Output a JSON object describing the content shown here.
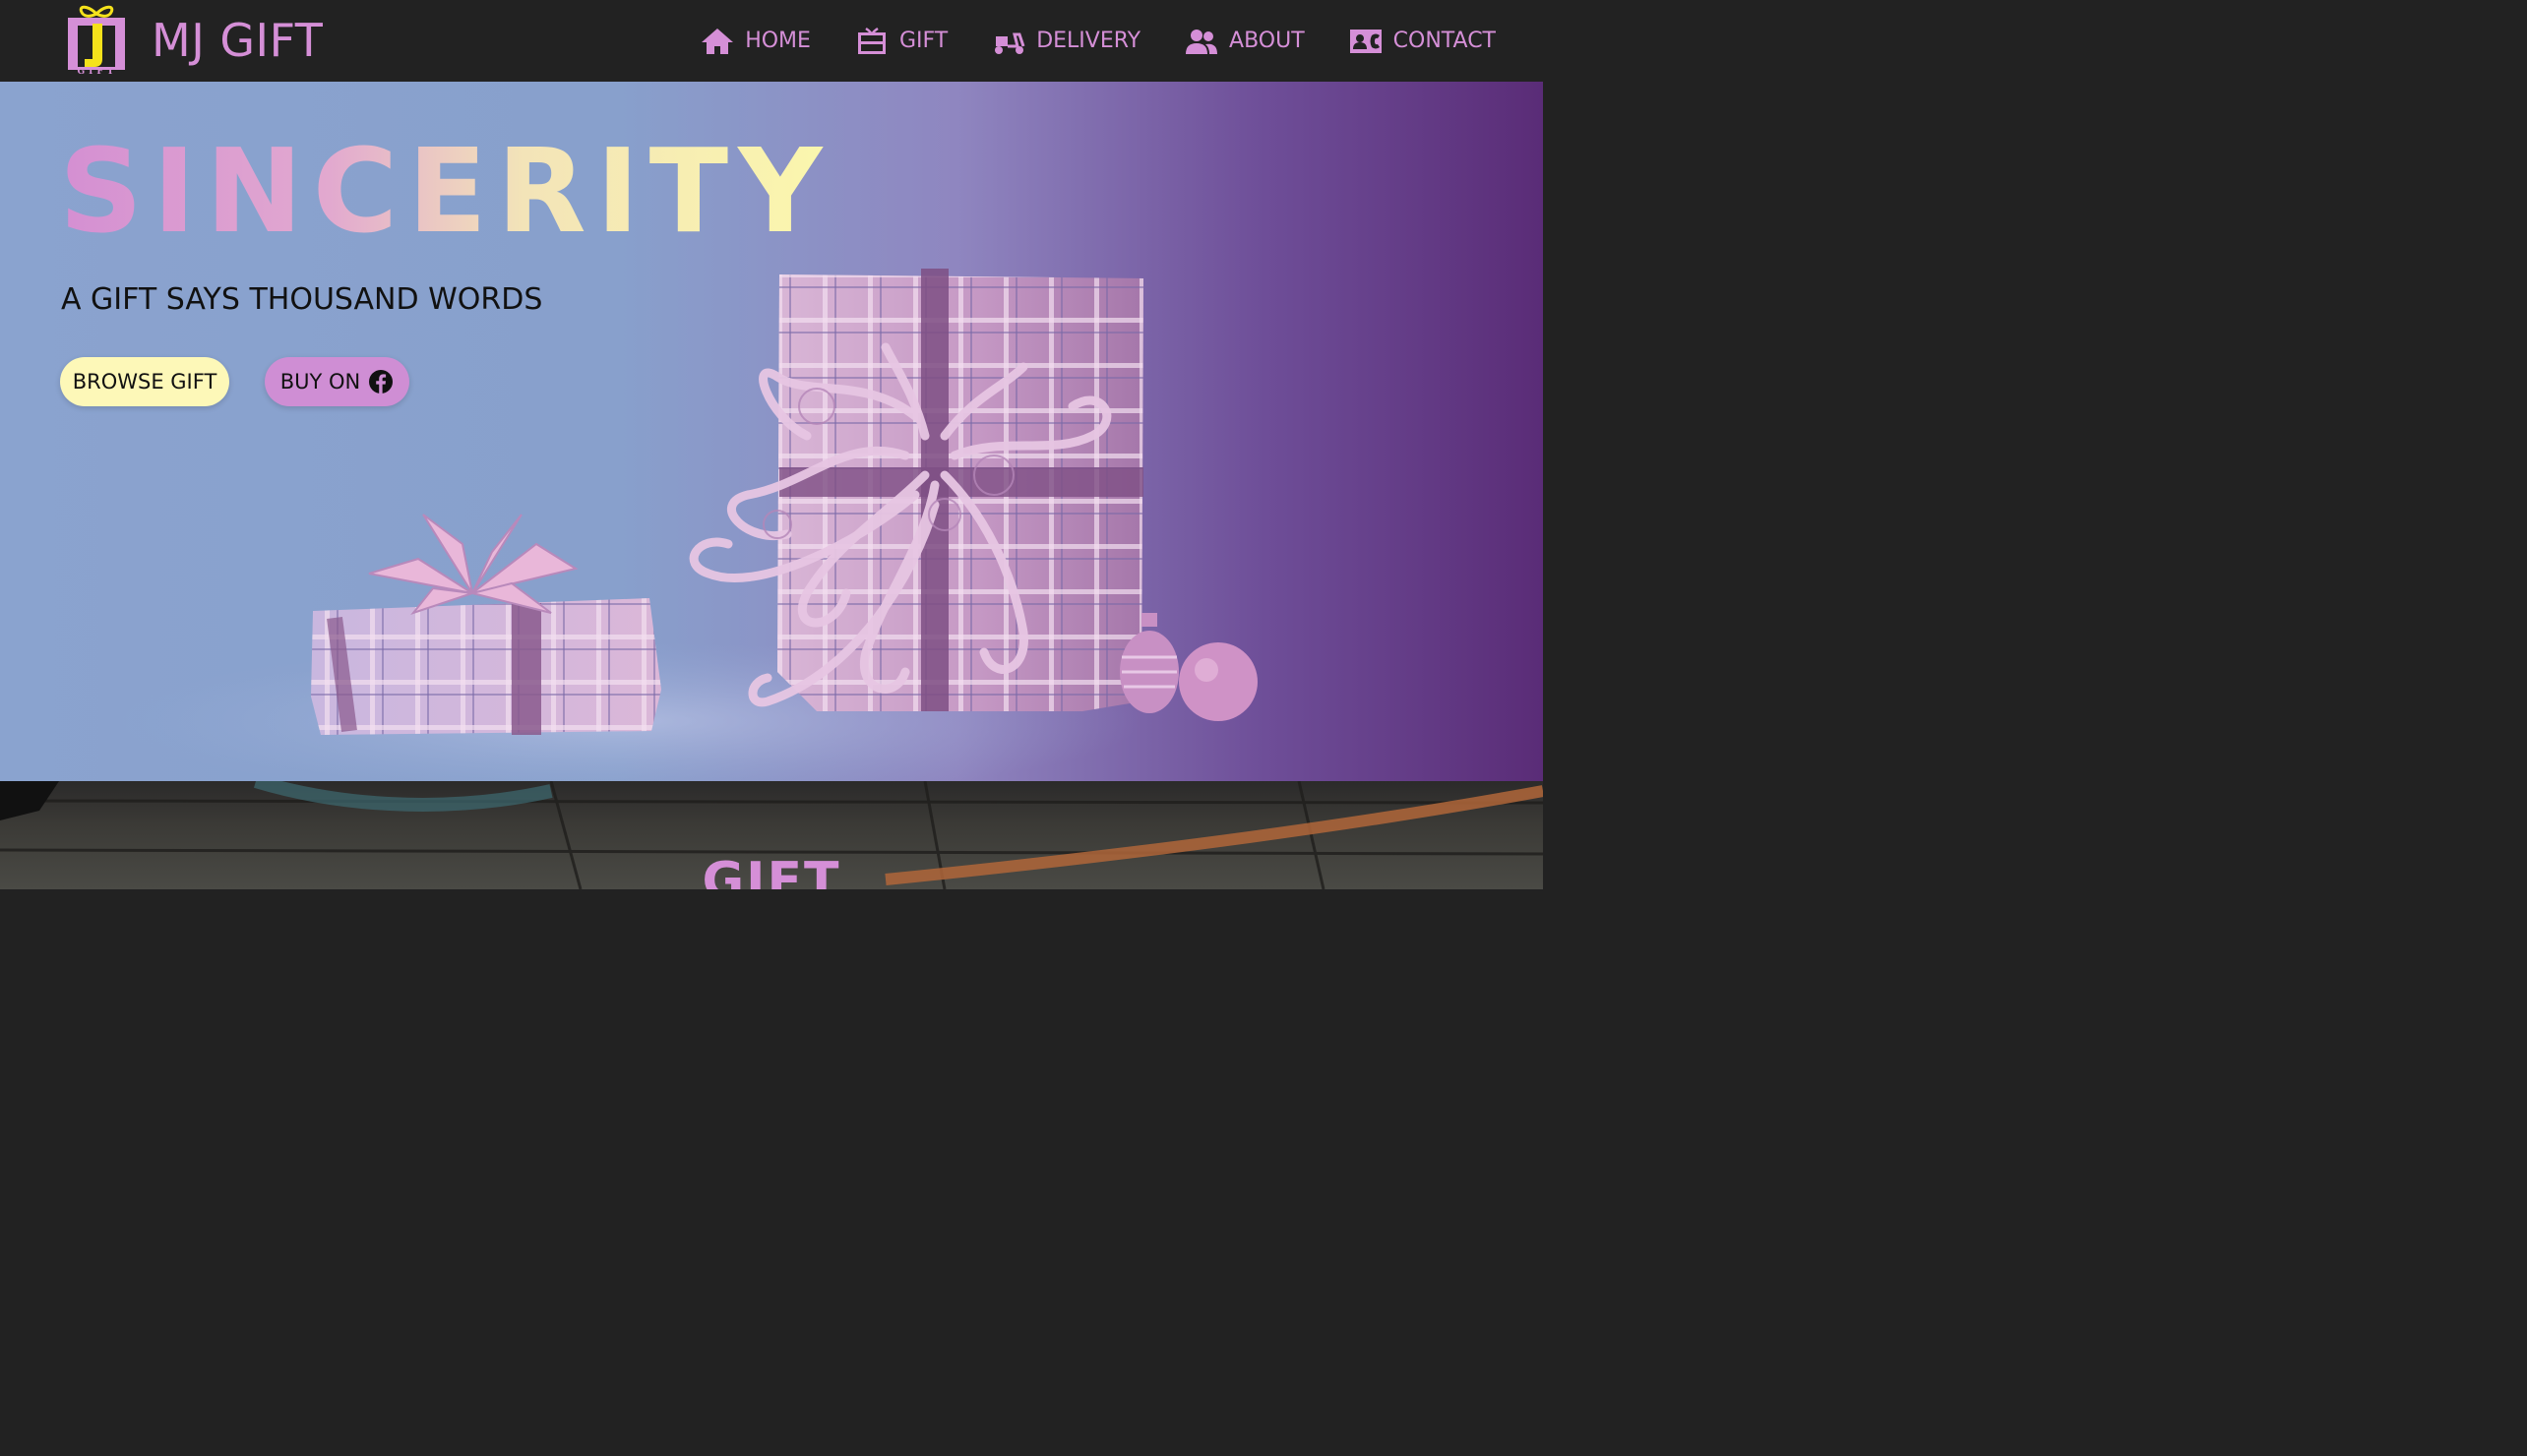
{
  "brand": {
    "name": "MJ GIFT",
    "logo_letters": "MJ",
    "logo_caption": "GIFT"
  },
  "nav": [
    {
      "label": "HOME",
      "icon": "home-icon"
    },
    {
      "label": "GIFT",
      "icon": "gift-card-icon"
    },
    {
      "label": "DELIVERY",
      "icon": "scooter-icon"
    },
    {
      "label": "ABOUT",
      "icon": "users-icon"
    },
    {
      "label": "CONTACT",
      "icon": "contact-card-icon"
    }
  ],
  "hero": {
    "title": "SINCERITY",
    "subtitle": "A GIFT SAYS THOUSAND WORDS",
    "browse_label": "BROWSE GIFT",
    "buy_label": "BUY ON",
    "buy_icon": "facebook-icon"
  },
  "section": {
    "title": "GIFT"
  },
  "colors": {
    "accent": "#d58fd7",
    "navbar_bg": "#222222",
    "browse_button": "#fdf8b8",
    "buy_button": "#cf8ed4",
    "logo_yellow": "#f5e21b"
  }
}
